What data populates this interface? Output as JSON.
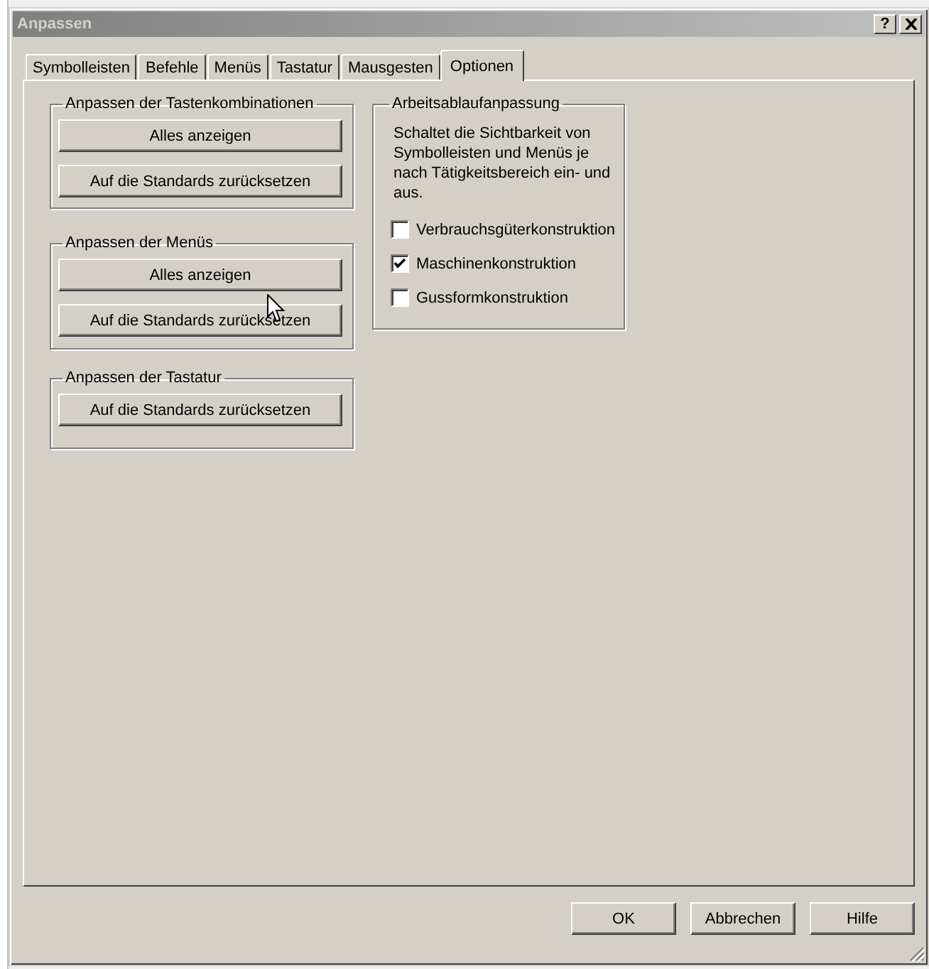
{
  "window": {
    "title": "Anpassen",
    "help_button": "?"
  },
  "tabs": [
    {
      "label": "Symbolleisten",
      "selected": false
    },
    {
      "label": "Befehle",
      "selected": false
    },
    {
      "label": "Menüs",
      "selected": false
    },
    {
      "label": "Tastatur",
      "selected": false
    },
    {
      "label": "Mausgesten",
      "selected": false
    },
    {
      "label": "Optionen",
      "selected": true
    }
  ],
  "groups": [
    {
      "title": "Anpassen der Tastenkombinationen",
      "buttons": [
        "Alles anzeigen",
        "Auf die Standards zurücksetzen"
      ]
    },
    {
      "title": "Anpassen der Menüs",
      "buttons": [
        "Alles anzeigen",
        "Auf die Standards zurücksetzen"
      ]
    },
    {
      "title": "Anpassen der Tastatur",
      "buttons": [
        "Auf die Standards zurücksetzen"
      ]
    }
  ],
  "workflow_group": {
    "title": "Arbeitsablaufanpassung",
    "description": "Schaltet die Sichtbarkeit von Symbolleisten und Menüs je nach Tätigkeitsbereich ein- und aus.",
    "options": [
      {
        "label": "Verbrauchsgüterkonstruktion",
        "checked": false
      },
      {
        "label": "Maschinenkonstruktion",
        "checked": true
      },
      {
        "label": "Gussformkonstruktion",
        "checked": false
      }
    ]
  },
  "buttons": [
    "OK",
    "Abbrechen",
    "Hilfe"
  ]
}
